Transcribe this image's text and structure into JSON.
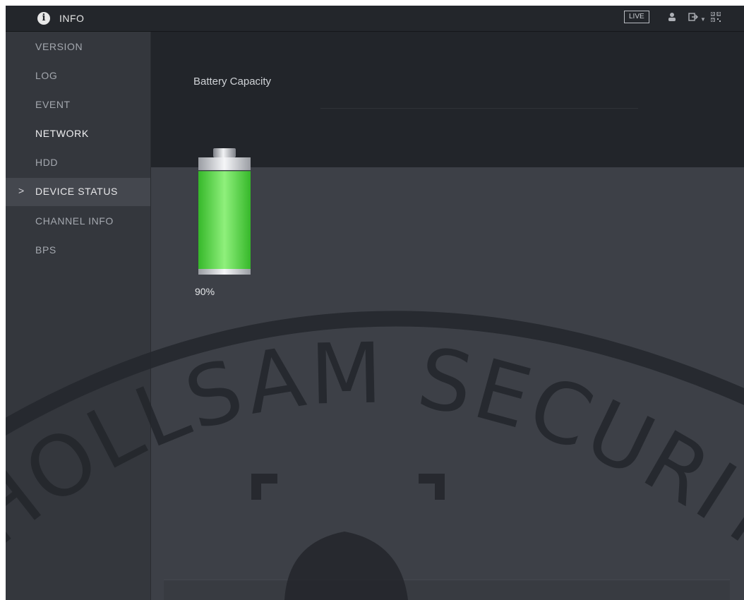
{
  "header": {
    "title": "INFO",
    "live_label": "LIVE",
    "icons": [
      "info-icon",
      "user-icon",
      "logout-icon",
      "chevron-down-icon",
      "qr-code-icon"
    ]
  },
  "sidebar": {
    "items": [
      {
        "label": "VERSION"
      },
      {
        "label": "LOG"
      },
      {
        "label": "EVENT"
      },
      {
        "label": "NETWORK"
      },
      {
        "label": "HDD"
      },
      {
        "label": "DEVICE STATUS",
        "selected": true
      },
      {
        "label": "CHANNEL INFO"
      },
      {
        "label": "BPS"
      }
    ],
    "selected_indicator": ">"
  },
  "main": {
    "section_title": "Battery Capacity",
    "battery": {
      "percent_label": "90%",
      "level": 0.9,
      "fill_color": "#4ccd3c"
    }
  },
  "watermark": {
    "text": "HOLLSAM SECURITY"
  },
  "colors": {
    "topbar": "#23262b",
    "sidebar": "#34373d",
    "content_bg": "#3d4047",
    "header_panel": "#22252a",
    "battery_green": "#4ccd3c"
  }
}
